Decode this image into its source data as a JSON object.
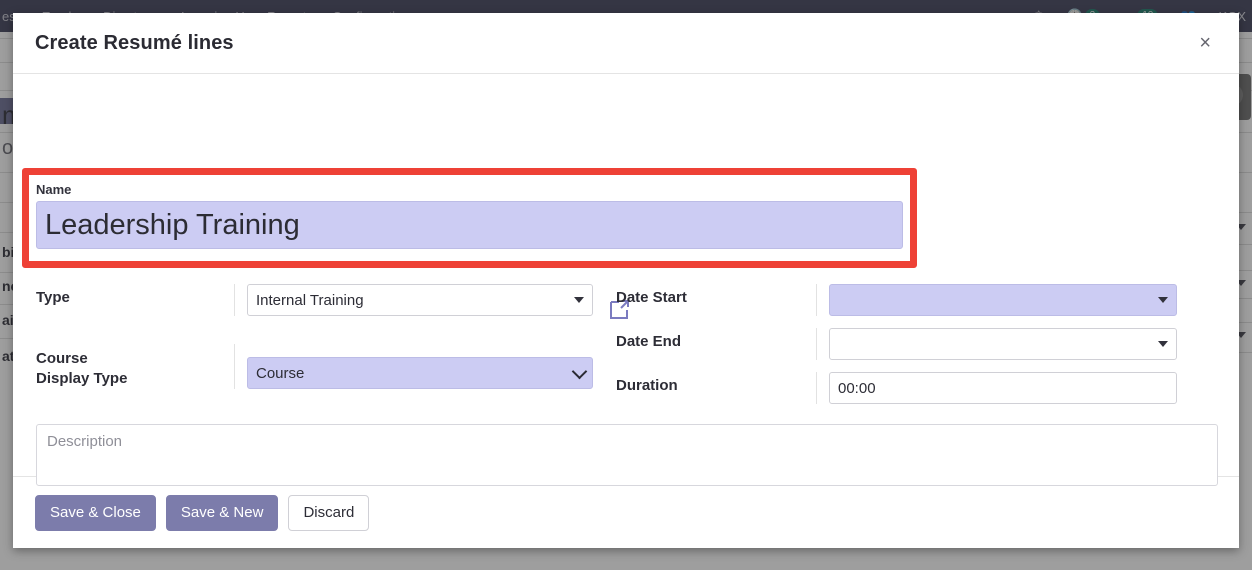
{
  "background": {
    "navbar": {
      "menu_items": [
        "es",
        "Employee Directory",
        "Learning Hour Report",
        "Configuration"
      ],
      "activities_badge": "2",
      "messages_badge": "10",
      "user_name": "KOX",
      "icons": [
        "crown-icon",
        "clock-activity-icon",
        "chat-messages-icon",
        "group-users-icon"
      ]
    },
    "left_fragments": [
      "m",
      "os",
      "bile",
      "ne",
      "ail",
      "ati"
    ]
  },
  "modal": {
    "title": "Create Resumé lines",
    "close_label": "×",
    "name": {
      "label": "Name",
      "value": "Leadership Training"
    },
    "type": {
      "label": "Type",
      "value": "Internal Training",
      "options": [
        "Internal Training"
      ]
    },
    "course_display_type": {
      "label_line1": "Course",
      "label_line2": "Display Type",
      "value": "Course",
      "options": [
        "Course"
      ]
    },
    "date_start": {
      "label": "Date Start",
      "value": "",
      "options": [
        ""
      ]
    },
    "date_end": {
      "label": "Date End",
      "value": "",
      "options": [
        ""
      ]
    },
    "duration": {
      "label": "Duration",
      "value": "00:00"
    },
    "description": {
      "placeholder": "Description",
      "value": ""
    },
    "footer": {
      "save_close_label": "Save & Close",
      "save_new_label": "Save & New",
      "discard_label": "Discard"
    }
  },
  "colors": {
    "highlight_field": "#ccccf3",
    "annotation_red": "#ee4136",
    "primary_button": "#7c7cab",
    "navbar": "#41435c",
    "badge_green": "#1c7f6e"
  }
}
